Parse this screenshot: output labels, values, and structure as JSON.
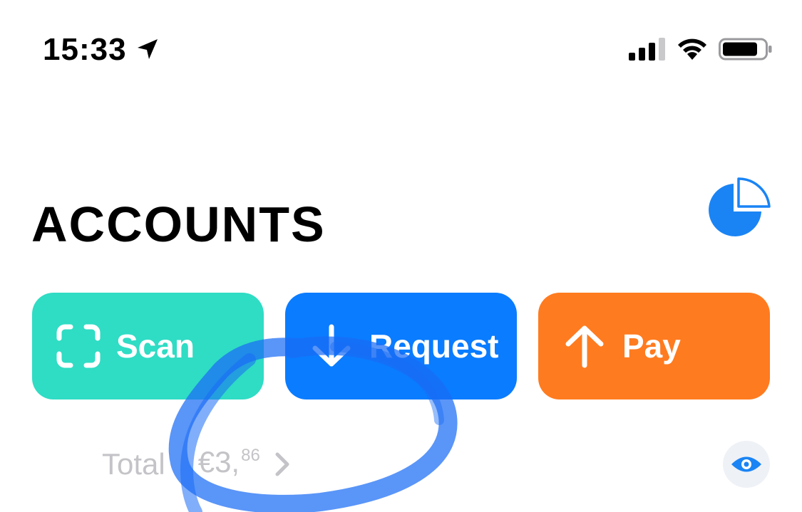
{
  "status_bar": {
    "time": "15:33",
    "icons": [
      "location-arrow-icon",
      "cellular-signal-icon",
      "wifi-icon",
      "battery-icon"
    ]
  },
  "header": {
    "title": "Accounts",
    "stats_icon": "pie-chart-icon"
  },
  "actions": {
    "scan": {
      "label": "Scan",
      "icon": "scan-frame-icon",
      "color": "#2fdcc4"
    },
    "request": {
      "label": "Request",
      "icon": "arrow-down-icon",
      "color": "#0a7cff"
    },
    "pay": {
      "label": "Pay",
      "icon": "arrow-up-icon",
      "color": "#ff7b1f"
    }
  },
  "total": {
    "label": "Total",
    "amount_main": "€3,",
    "amount_cents": "86",
    "chevron_icon": "chevron-right-icon",
    "visibility_icon": "eye-icon"
  },
  "colors": {
    "accent_blue": "#0a7cff",
    "muted_text": "#c4c4c8",
    "scribble_blue": "#1a6cf5"
  }
}
